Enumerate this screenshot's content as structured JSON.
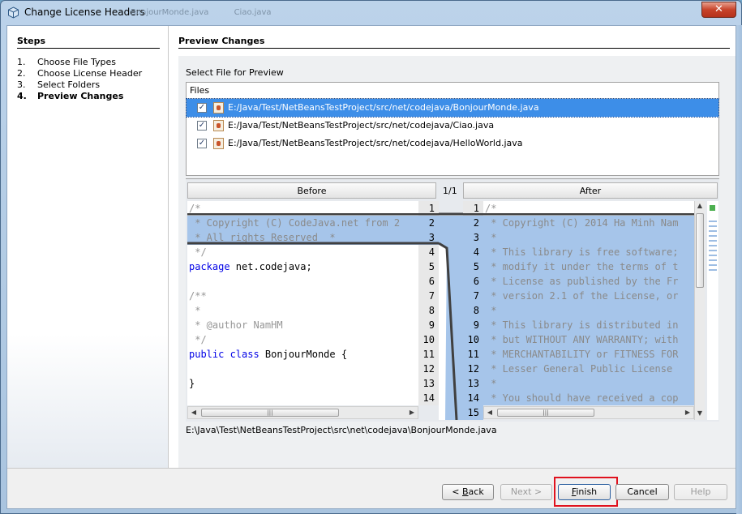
{
  "window": {
    "title": "Change License Headers",
    "background_tabs": [
      "BonjourMonde.java",
      "Ciao.java"
    ],
    "close_symbol": "✕"
  },
  "steps": {
    "title": "Steps",
    "items": [
      {
        "num": "1.",
        "label": "Choose File Types"
      },
      {
        "num": "2.",
        "label": "Choose License Header"
      },
      {
        "num": "3.",
        "label": "Select Folders"
      },
      {
        "num": "4.",
        "label": "Preview Changes",
        "active": true
      }
    ]
  },
  "main": {
    "title": "Preview Changes",
    "select_label": "Select File for Preview",
    "files_header": "Files",
    "files": [
      {
        "path": "E:/Java/Test/NetBeansTestProject/src/net/codejava/BonjourMonde.java",
        "checked": true,
        "selected": true
      },
      {
        "path": "E:/Java/Test/NetBeansTestProject/src/net/codejava/Ciao.java",
        "checked": true,
        "selected": false
      },
      {
        "path": "E:/Java/Test/NetBeansTestProject/src/net/codejava/HelloWorld.java",
        "checked": true,
        "selected": false
      }
    ]
  },
  "diff": {
    "before_label": "Before",
    "after_label": "After",
    "position": "1/1",
    "before_lines": [
      {
        "n": "1",
        "text": "/*",
        "chg": false,
        "kind": "cm"
      },
      {
        "n": "2",
        "text": " * Copyright (C) CodeJava.net from 2",
        "chg": true,
        "kind": "cm"
      },
      {
        "n": "3",
        "text": " * All rights Reserved  *",
        "chg": true,
        "kind": "cm"
      },
      {
        "n": "4",
        "text": " */",
        "chg": false,
        "kind": "cm"
      },
      {
        "n": "5",
        "text": "package net.codejava;",
        "chg": false,
        "kind": "pkg"
      },
      {
        "n": "6",
        "text": "",
        "chg": false,
        "kind": "plain"
      },
      {
        "n": "7",
        "text": "/**",
        "chg": false,
        "kind": "cm"
      },
      {
        "n": "8",
        "text": " *",
        "chg": false,
        "kind": "cm"
      },
      {
        "n": "9",
        "text": " * @author NamHM",
        "chg": false,
        "kind": "cm"
      },
      {
        "n": "10",
        "text": " */",
        "chg": false,
        "kind": "cm"
      },
      {
        "n": "11",
        "text": "public class BonjourMonde {",
        "chg": false,
        "kind": "cls"
      },
      {
        "n": "12",
        "text": "",
        "chg": false,
        "kind": "plain"
      },
      {
        "n": "13",
        "text": "}",
        "chg": false,
        "kind": "plain"
      },
      {
        "n": "14",
        "text": "",
        "chg": false,
        "kind": "plain"
      }
    ],
    "after_lines": [
      {
        "n": "1",
        "text": "/*",
        "chg": false
      },
      {
        "n": "2",
        "text": " * Copyright (C) 2014 Ha Minh Nam",
        "chg": true
      },
      {
        "n": "3",
        "text": " *",
        "chg": true
      },
      {
        "n": "4",
        "text": " * This library is free software;",
        "chg": true
      },
      {
        "n": "5",
        "text": " * modify it under the terms of t",
        "chg": true
      },
      {
        "n": "6",
        "text": " * License as published by the Fr",
        "chg": true
      },
      {
        "n": "7",
        "text": " * version 2.1 of the License, or",
        "chg": true
      },
      {
        "n": "8",
        "text": " *",
        "chg": true
      },
      {
        "n": "9",
        "text": " * This library is distributed in",
        "chg": true
      },
      {
        "n": "10",
        "text": " * but WITHOUT ANY WARRANTY; with",
        "chg": true
      },
      {
        "n": "11",
        "text": " * MERCHANTABILITY or FITNESS FOR",
        "chg": true
      },
      {
        "n": "12",
        "text": " * Lesser General Public License",
        "chg": true
      },
      {
        "n": "13",
        "text": " *",
        "chg": true
      },
      {
        "n": "14",
        "text": " * You should have received a cop",
        "chg": true
      },
      {
        "n": "15",
        "text": "",
        "chg": true
      }
    ],
    "current_path": "E:\\Java\\Test\\NetBeansTestProject\\src\\net\\codejava\\BonjourMonde.java"
  },
  "buttons": {
    "back": {
      "prefix": "< ",
      "mnemonic": "B",
      "rest": "ack",
      "enabled": true
    },
    "next": {
      "label": "Next >",
      "enabled": false
    },
    "finish": {
      "mnemonic": "F",
      "rest": "inish",
      "enabled": true
    },
    "cancel": {
      "label": "Cancel",
      "enabled": true
    },
    "help": {
      "label": "Help",
      "enabled": false
    }
  },
  "colors": {
    "selection": "#3d8ee8",
    "changed": "#a6c5ea",
    "highlight_box": "#e0121e",
    "keyword": "#0000e6"
  }
}
